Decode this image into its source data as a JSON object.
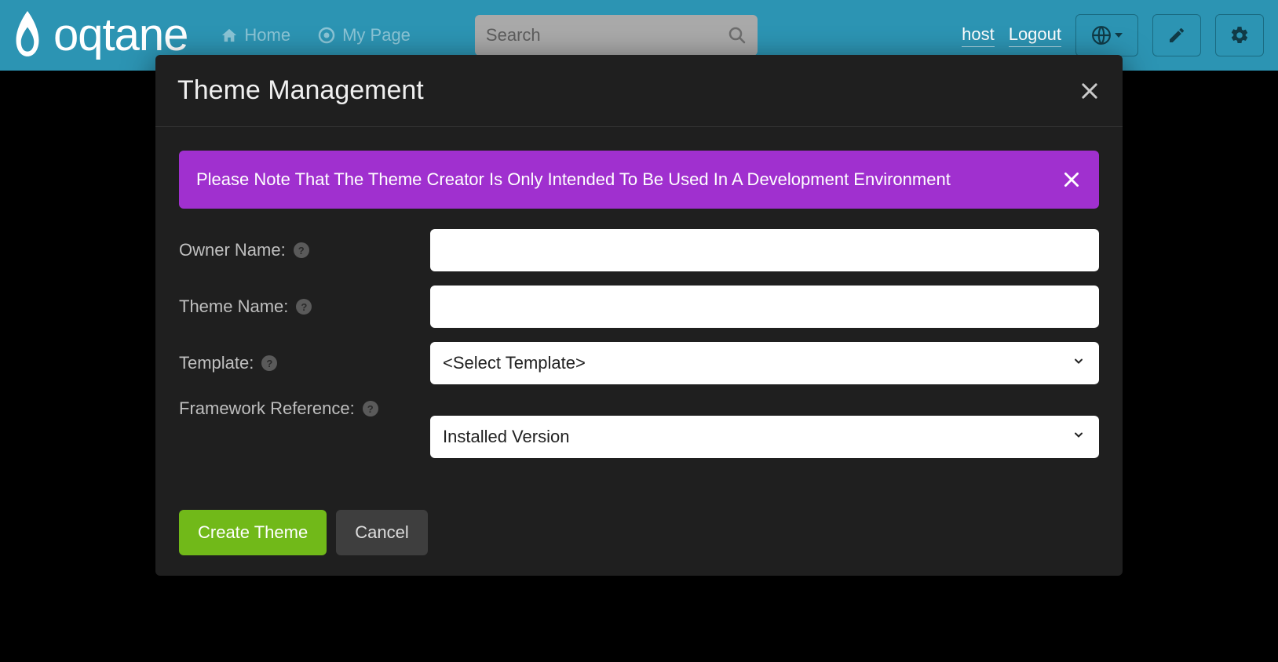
{
  "brand": {
    "text": "oqtane"
  },
  "nav": {
    "home": "Home",
    "mypage": "My Page"
  },
  "search": {
    "placeholder": "Search"
  },
  "user": {
    "name": "host",
    "logout": "Logout"
  },
  "modal": {
    "title": "Theme Management",
    "alert": "Please Note That The Theme Creator Is Only Intended To Be Used In A Development Environment",
    "fields": {
      "owner_label": "Owner Name:",
      "owner_value": "",
      "theme_label": "Theme Name:",
      "theme_value": "",
      "template_label": "Template:",
      "template_selected": "<Select Template>",
      "framework_label": "Framework Reference:",
      "framework_selected": "Installed Version"
    },
    "buttons": {
      "create": "Create Theme",
      "cancel": "Cancel"
    }
  }
}
